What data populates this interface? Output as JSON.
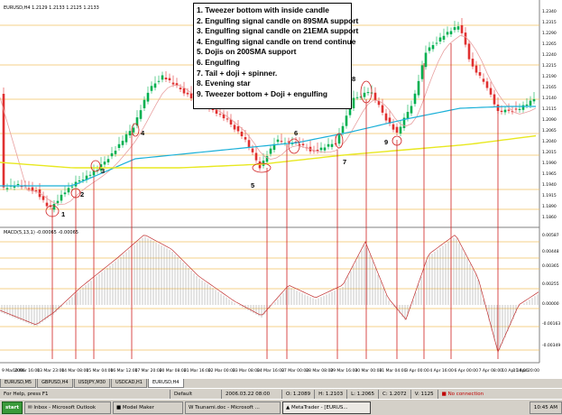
{
  "window": {
    "symbol_header": "EURUSD,H4  1.2129 1.2133 1.2125 1.2133",
    "macd_header": "MACD(5,13,1) -0.00065 -0.00065"
  },
  "legend": {
    "lines": [
      "1. Tweezer bottom with inside candle",
      "2. Engulfing signal candle on 89SMA support",
      "3. Engulfing signal candle on 21EMA support",
      "4. Engulfing signal candle on trend continue",
      "5. Dojis on 200SMA support",
      "6. Engulfing",
      "7. Tail + doji + spinner.",
      "8. Evening star",
      "9. Tweezer bottom + Doji + engulfing"
    ]
  },
  "markers": [
    "1",
    "2",
    "3",
    "4",
    "5",
    "6",
    "7",
    "8",
    "9"
  ],
  "price_axis": [
    "1.2340",
    "1.2315",
    "1.2290",
    "1.2265",
    "1.2240",
    "1.2215",
    "1.2190",
    "1.2165",
    "1.2140",
    "1.2115",
    "1.2090",
    "1.2065",
    "1.2040",
    "1.2015",
    "1.1990",
    "1.1965",
    "1.1940",
    "1.1915",
    "1.1890",
    "1.1860"
  ],
  "macd_axis": [
    "0.00587",
    "0.00448",
    "0.00365",
    "0.00255",
    "0.00000",
    "-0.00163",
    "-0.00349"
  ],
  "time_axis": [
    "9 Mar 2006",
    "10 Mar 16:00",
    "13 Mar 23:00",
    "14 Mar 08:00",
    "15 Mar 04:00",
    "16 Mar 12:00",
    "17 Mar 20:00",
    "20 Mar 08:00",
    "21 Mar 16:00",
    "22 Mar 00:00",
    "23 Mar 08:00",
    "24 Mar 16:00",
    "27 Mar 00:00",
    "28 Mar 08:00",
    "29 Mar 16:00",
    "30 Mar 00:00",
    "31 Mar 04:00",
    "3 Apr 00:00",
    "4 Apr 16:00",
    "6 Apr 00:00",
    "7 Apr 08:00",
    "10 Apr 16:00",
    "11 Apr 20:00"
  ],
  "tabs": [
    "EURUSD,M5",
    "GBPUSD,H4",
    "USDJPY,M30",
    "USDCAD,H1",
    "EURUSD,H4"
  ],
  "status": {
    "help": "For Help, press F1",
    "profile": "Default",
    "datetime": "2006.03.22 08:00",
    "open": "O: 1.2089",
    "high": "H: 1.2103",
    "low": "L: 1.2065",
    "close": "C: 1.2072",
    "volume": "V: 1125",
    "traffic": "3/0 kb",
    "connection": "No connection"
  },
  "taskbar": {
    "start": "start",
    "items": [
      "Inbox - Microsoft Outlook",
      "Model Maker",
      "Tsunami.doc - Microsoft ...",
      "MetaTrader - [EURUS..."
    ],
    "clock": "10:45 AM"
  },
  "colors": {
    "bull": "#00b050",
    "bear": "#e03030",
    "ema21": "#e8a0a0",
    "sma89": "#1ab0d8",
    "sma200": "#e8e820",
    "macd_line": "#c03030",
    "macd_hist": "#909090",
    "level_line": "#f0c060",
    "signal_line": "#d02020"
  }
}
